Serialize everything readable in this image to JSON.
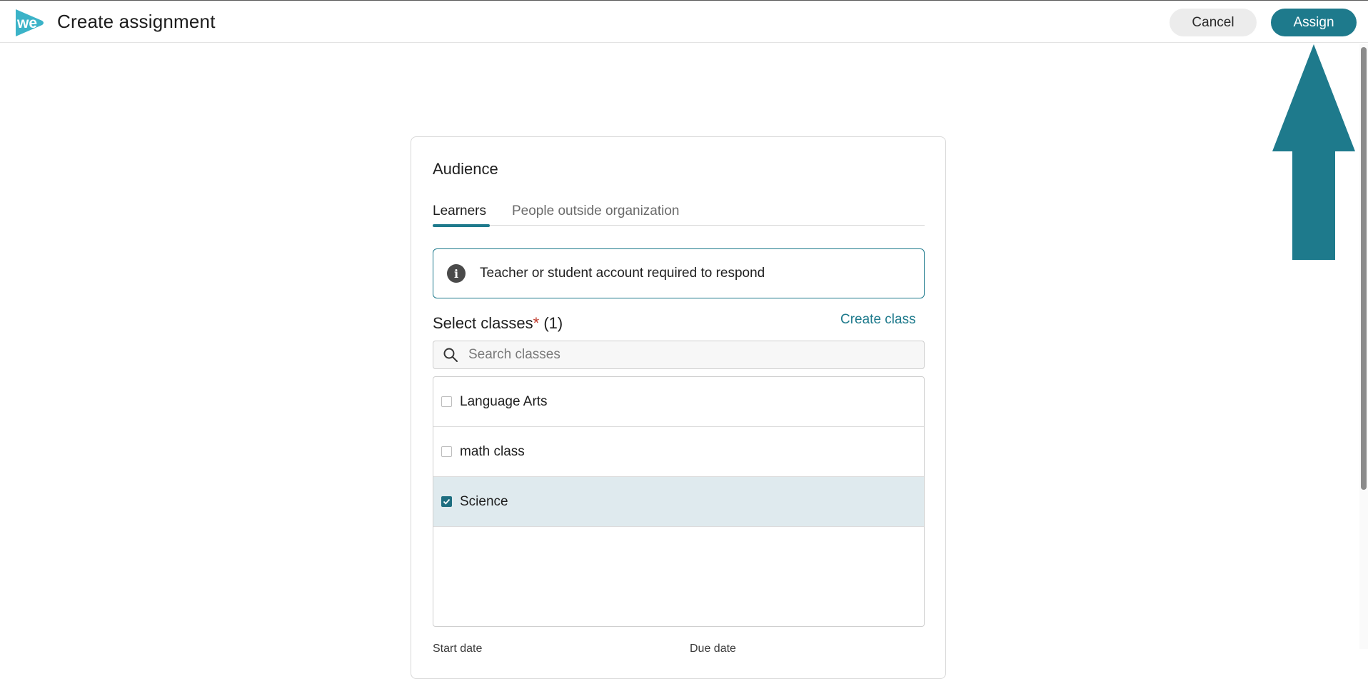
{
  "header": {
    "logo_text": "we",
    "title": "Create assignment",
    "cancel_label": "Cancel",
    "assign_label": "Assign"
  },
  "audience": {
    "title": "Audience",
    "tabs": [
      {
        "label": "Learners",
        "active": true
      },
      {
        "label": "People outside organization",
        "active": false
      }
    ],
    "info_text": "Teacher or student account required to respond",
    "select_label": "Select classes",
    "required_mark": "*",
    "selected_count": "(1)",
    "create_class_label": "Create class",
    "search_placeholder": "Search classes",
    "classes": [
      {
        "label": "Language Arts",
        "checked": false
      },
      {
        "label": "math class",
        "checked": false
      },
      {
        "label": "Science",
        "checked": true
      }
    ],
    "start_date_label": "Start date",
    "due_date_label": "Due date"
  },
  "colors": {
    "accent": "#1e7a8c",
    "selected_row": "#dfeaee",
    "logo": "#3bb3c8"
  },
  "icons": {
    "info": "info-icon",
    "search": "search-icon",
    "annotation": "arrow-up-icon"
  }
}
